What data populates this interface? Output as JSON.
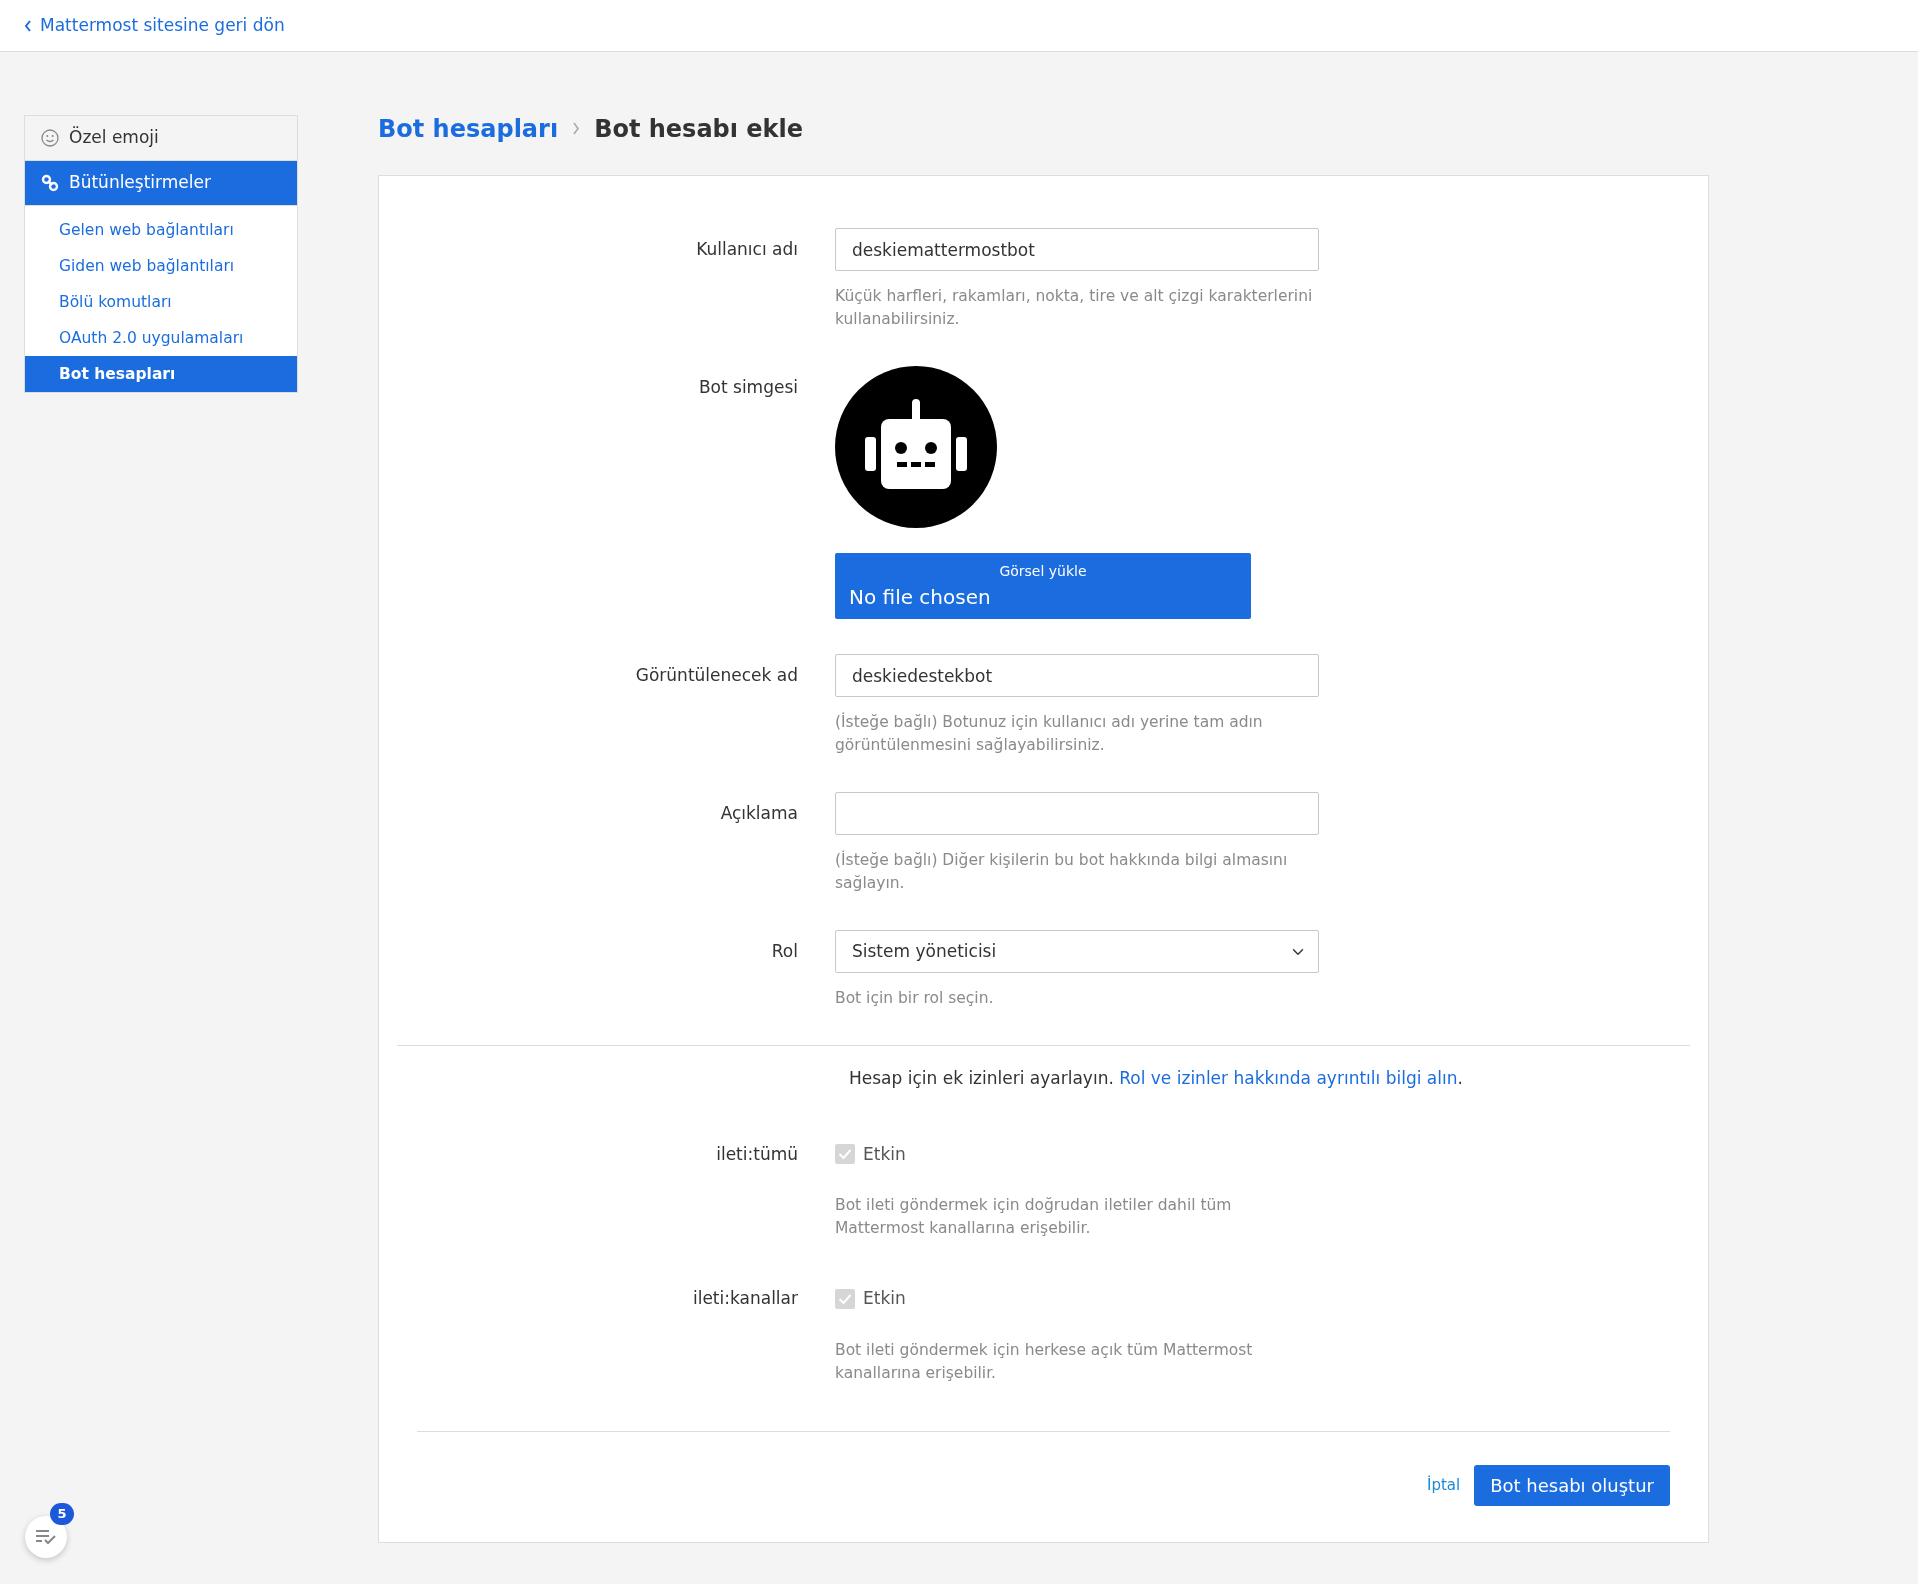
{
  "back_link": {
    "label": "Mattermost sitesine geri dön"
  },
  "sidebar": {
    "items": [
      {
        "kind": "emoji",
        "label": "Özel emoji",
        "selected": false
      },
      {
        "kind": "integrations",
        "label": "Bütünleştirmeler",
        "selected": true,
        "children": [
          {
            "label": "Gelen web bağlantıları",
            "selected": false
          },
          {
            "label": "Giden web bağlantıları",
            "selected": false
          },
          {
            "label": "Bölü komutları",
            "selected": false
          },
          {
            "label": "OAuth 2.0 uygulamaları",
            "selected": false
          },
          {
            "label": "Bot hesapları",
            "selected": true
          }
        ]
      }
    ]
  },
  "breadcrumb": {
    "parent": "Bot hesapları",
    "current": "Bot hesabı ekle"
  },
  "fields": [
    {
      "kind": "text",
      "label": "Kullanıcı adı",
      "value": "deskiemattermostbot",
      "help": "Küçük harfleri, rakamları, nokta, tire ve alt çizgi karakterlerini kullanabilirsiniz."
    },
    {
      "kind": "image",
      "label": "Bot simgesi",
      "upload_button": "Görsel yükle",
      "file_status": "No file chosen"
    },
    {
      "kind": "text",
      "label": "Görüntülenecek ad",
      "value": "deskiedestekbot",
      "help": "(İsteğe bağlı) Botunuz için kullanıcı adı yerine tam adın görüntülenmesini sağlayabilirsiniz."
    },
    {
      "kind": "text",
      "label": "Açıklama",
      "help": "(İsteğe bağlı) Diğer kişilerin bu bot hakkında bilgi almasını sağlayın."
    },
    {
      "kind": "select",
      "label": "Rol",
      "value": "Sistem yöneticisi",
      "help": "Bot için bir rol seçin."
    }
  ],
  "permissions": {
    "intro": "Hesap için ek izinleri ayarlayın.",
    "link": "Rol ve izinler hakkında ayrıntılı bilgi alın",
    "after": ".",
    "items": [
      {
        "label": "ileti:tümü",
        "option": "Etkin",
        "checked": true,
        "disabled": true,
        "help": "Bot ileti göndermek için doğrudan iletiler dahil tüm Mattermost kanallarına erişebilir."
      },
      {
        "label": "ileti:kanallar",
        "option": "Etkin",
        "checked": true,
        "disabled": true,
        "help": "Bot ileti göndermek için herkese açık tüm Mattermost kanallarına erişebilir."
      }
    ]
  },
  "actions": {
    "cancel": "İptal",
    "submit": "Bot hesabı oluştur"
  },
  "task_badge": {
    "count": "5"
  }
}
